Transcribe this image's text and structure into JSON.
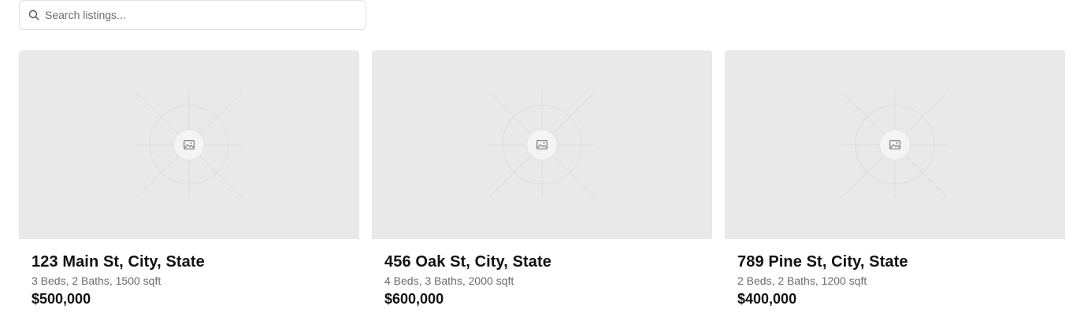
{
  "search": {
    "placeholder": "Search listings...",
    "value": ""
  },
  "listings": [
    {
      "address": "123 Main St, City, State",
      "details": "3 Beds, 2 Baths, 1500 sqft",
      "price": "$500,000"
    },
    {
      "address": "456 Oak St, City, State",
      "details": "4 Beds, 3 Baths, 2000 sqft",
      "price": "$600,000"
    },
    {
      "address": "789 Pine St, City, State",
      "details": "2 Beds, 2 Baths, 1200 sqft",
      "price": "$400,000"
    }
  ],
  "icons": {
    "search": "search-icon",
    "image_placeholder": "image-placeholder-icon"
  },
  "colors": {
    "placeholder_bg": "#e9e9e9",
    "muted_text": "#6b6b6b",
    "text": "#111111"
  }
}
